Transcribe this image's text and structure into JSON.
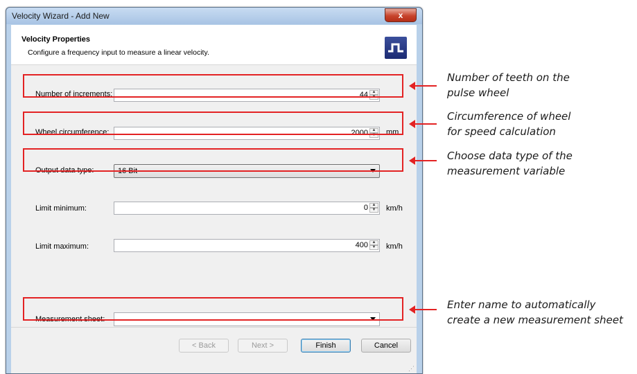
{
  "window": {
    "title": "Velocity Wizard - Add New",
    "close_glyph": "x"
  },
  "header": {
    "title": "Velocity Properties",
    "subtitle": "Configure a frequency input to measure a linear velocity.",
    "icon": "pulse-wave-icon"
  },
  "fields": {
    "increments": {
      "label": "Number of increments:",
      "value": "44"
    },
    "circumference": {
      "label": "Wheel circumference:",
      "value": "2000",
      "unit": "mm"
    },
    "output_type": {
      "label": "Output data type:",
      "value": "16 Bit"
    },
    "limit_min": {
      "label": "Limit minimum:",
      "value": "0",
      "unit": "km/h"
    },
    "limit_max": {
      "label": "Limit maximum:",
      "value": "400",
      "unit": "km/h"
    },
    "sheet": {
      "label": "Measurement sheet:",
      "value": ""
    }
  },
  "buttons": {
    "back": "< Back",
    "next": "Next >",
    "finish": "Finish",
    "cancel": "Cancel"
  },
  "annotations": {
    "increments": [
      "Number of teeth on the",
      "pulse wheel"
    ],
    "circumference": [
      "Circumference of wheel",
      "for speed calculation"
    ],
    "output_type": [
      "Choose data type of the",
      "measurement variable"
    ],
    "sheet": [
      "Enter name to automatically",
      "create a new measurement sheet"
    ]
  },
  "colors": {
    "highlight": "#e32223",
    "dialog_bg": "#f0f0f0",
    "titlebar": "#b9d1ea"
  }
}
